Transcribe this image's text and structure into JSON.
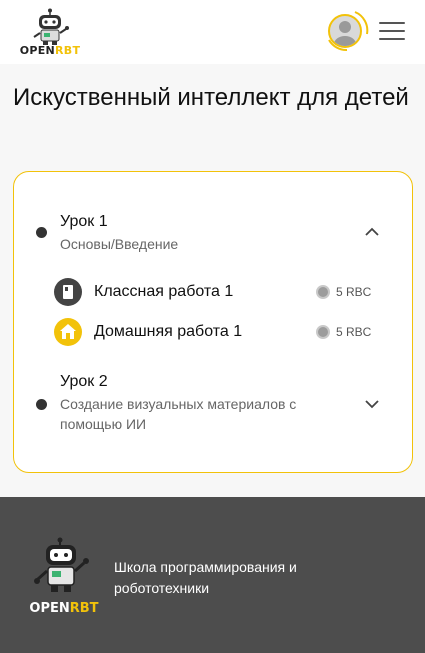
{
  "header": {
    "logo": {
      "part1": "OPEN",
      "part2": "RBT"
    },
    "avatar_icon": "user-avatar-icon",
    "menu_icon": "hamburger-menu-icon"
  },
  "page": {
    "title": "Искуственный интеллект для детей"
  },
  "lessons": [
    {
      "title": "Урок 1",
      "subtitle": "Основы/Введение",
      "expanded": true,
      "chevron_icon": "chevron-up-icon",
      "tasks": [
        {
          "label": "Классная работа 1",
          "cost": "5 RBC",
          "icon": "classwork-icon",
          "icon_color": "#444444"
        },
        {
          "label": "Домашняя работа 1",
          "cost": "5 RBC",
          "icon": "homework-house-icon",
          "icon_color": "#f2c20a"
        }
      ]
    },
    {
      "title": "Урок 2",
      "subtitle": "Создание визуальных материалов с помощью ИИ",
      "expanded": false,
      "chevron_icon": "chevron-down-icon"
    }
  ],
  "footer": {
    "logo": {
      "part1": "OPEN",
      "part2": "RBT"
    },
    "text": "Школа программирования и робототехники"
  },
  "colors": {
    "accent": "#f2c20a",
    "footer_bg": "#4d4d4d",
    "page_bg": "#f7f7f7"
  }
}
